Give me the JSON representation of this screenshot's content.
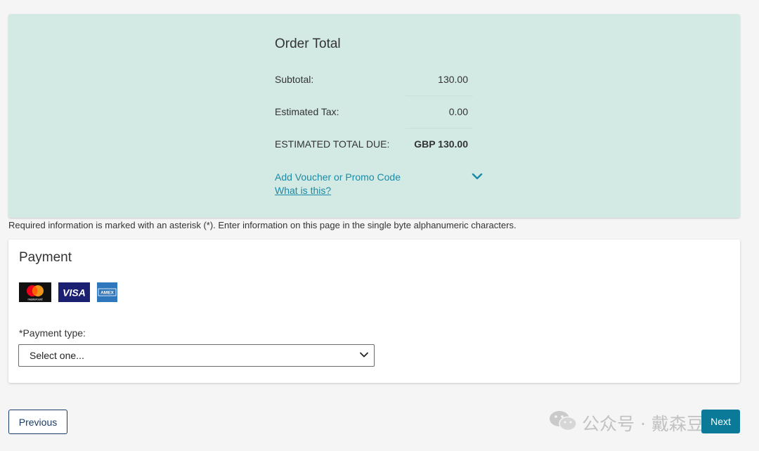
{
  "order_total": {
    "title": "Order Total",
    "subtotal_label": "Subtotal:",
    "subtotal_value": "130.00",
    "tax_label": "Estimated Tax:",
    "tax_value": "0.00",
    "total_label": "ESTIMATED TOTAL DUE:",
    "total_value": "GBP 130.00",
    "voucher_link": "Add Voucher or Promo Code",
    "voucher_icon": "chevron-down-icon",
    "what_is_this_link": "What is this?",
    "panel_color": "#d3eae4",
    "link_color": "#1a8aa6"
  },
  "required_note": "Required information is marked with an asterisk (*). Enter information on this page in the single byte alphanumeric characters.",
  "payment": {
    "title": "Payment",
    "card_logos": [
      "mastercard-logo",
      "visa-logo",
      "amex-logo"
    ],
    "mastercard_text": "mastercard",
    "visa_text": "VISA",
    "amex_text": "AMEX",
    "payment_type_label": "*Payment type:",
    "payment_type_selected": "Select one..."
  },
  "footer": {
    "previous_label": "Previous",
    "next_label": "Next",
    "next_color": "#0b7a98"
  },
  "watermark": {
    "text": "公众号 · 戴森豆",
    "icon": "wechat-icon"
  }
}
